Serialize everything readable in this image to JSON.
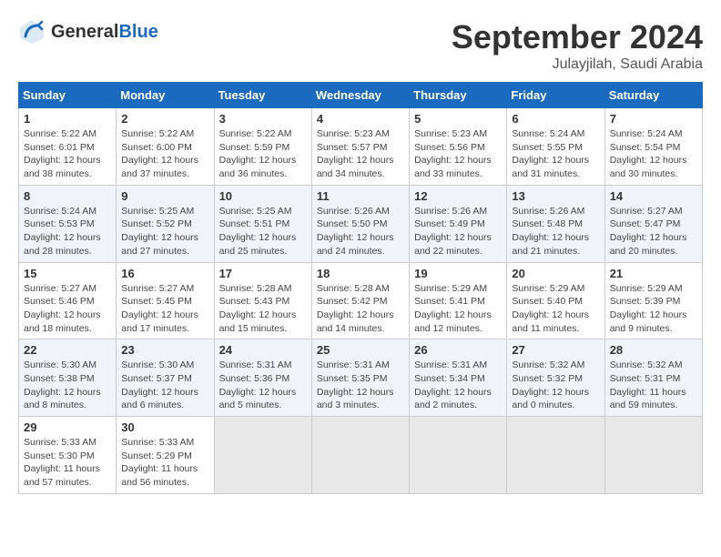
{
  "header": {
    "logo_general": "General",
    "logo_blue": "Blue",
    "month": "September 2024",
    "location": "Julayjilah, Saudi Arabia"
  },
  "weekdays": [
    "Sunday",
    "Monday",
    "Tuesday",
    "Wednesday",
    "Thursday",
    "Friday",
    "Saturday"
  ],
  "weeks": [
    [
      {
        "day": "1",
        "sunrise": "5:22 AM",
        "sunset": "6:01 PM",
        "daylight": "12 hours and 38 minutes."
      },
      {
        "day": "2",
        "sunrise": "5:22 AM",
        "sunset": "6:00 PM",
        "daylight": "12 hours and 37 minutes."
      },
      {
        "day": "3",
        "sunrise": "5:22 AM",
        "sunset": "5:59 PM",
        "daylight": "12 hours and 36 minutes."
      },
      {
        "day": "4",
        "sunrise": "5:23 AM",
        "sunset": "5:57 PM",
        "daylight": "12 hours and 34 minutes."
      },
      {
        "day": "5",
        "sunrise": "5:23 AM",
        "sunset": "5:56 PM",
        "daylight": "12 hours and 33 minutes."
      },
      {
        "day": "6",
        "sunrise": "5:24 AM",
        "sunset": "5:55 PM",
        "daylight": "12 hours and 31 minutes."
      },
      {
        "day": "7",
        "sunrise": "5:24 AM",
        "sunset": "5:54 PM",
        "daylight": "12 hours and 30 minutes."
      }
    ],
    [
      {
        "day": "8",
        "sunrise": "5:24 AM",
        "sunset": "5:53 PM",
        "daylight": "12 hours and 28 minutes."
      },
      {
        "day": "9",
        "sunrise": "5:25 AM",
        "sunset": "5:52 PM",
        "daylight": "12 hours and 27 minutes."
      },
      {
        "day": "10",
        "sunrise": "5:25 AM",
        "sunset": "5:51 PM",
        "daylight": "12 hours and 25 minutes."
      },
      {
        "day": "11",
        "sunrise": "5:26 AM",
        "sunset": "5:50 PM",
        "daylight": "12 hours and 24 minutes."
      },
      {
        "day": "12",
        "sunrise": "5:26 AM",
        "sunset": "5:49 PM",
        "daylight": "12 hours and 22 minutes."
      },
      {
        "day": "13",
        "sunrise": "5:26 AM",
        "sunset": "5:48 PM",
        "daylight": "12 hours and 21 minutes."
      },
      {
        "day": "14",
        "sunrise": "5:27 AM",
        "sunset": "5:47 PM",
        "daylight": "12 hours and 20 minutes."
      }
    ],
    [
      {
        "day": "15",
        "sunrise": "5:27 AM",
        "sunset": "5:46 PM",
        "daylight": "12 hours and 18 minutes."
      },
      {
        "day": "16",
        "sunrise": "5:27 AM",
        "sunset": "5:45 PM",
        "daylight": "12 hours and 17 minutes."
      },
      {
        "day": "17",
        "sunrise": "5:28 AM",
        "sunset": "5:43 PM",
        "daylight": "12 hours and 15 minutes."
      },
      {
        "day": "18",
        "sunrise": "5:28 AM",
        "sunset": "5:42 PM",
        "daylight": "12 hours and 14 minutes."
      },
      {
        "day": "19",
        "sunrise": "5:29 AM",
        "sunset": "5:41 PM",
        "daylight": "12 hours and 12 minutes."
      },
      {
        "day": "20",
        "sunrise": "5:29 AM",
        "sunset": "5:40 PM",
        "daylight": "12 hours and 11 minutes."
      },
      {
        "day": "21",
        "sunrise": "5:29 AM",
        "sunset": "5:39 PM",
        "daylight": "12 hours and 9 minutes."
      }
    ],
    [
      {
        "day": "22",
        "sunrise": "5:30 AM",
        "sunset": "5:38 PM",
        "daylight": "12 hours and 8 minutes."
      },
      {
        "day": "23",
        "sunrise": "5:30 AM",
        "sunset": "5:37 PM",
        "daylight": "12 hours and 6 minutes."
      },
      {
        "day": "24",
        "sunrise": "5:31 AM",
        "sunset": "5:36 PM",
        "daylight": "12 hours and 5 minutes."
      },
      {
        "day": "25",
        "sunrise": "5:31 AM",
        "sunset": "5:35 PM",
        "daylight": "12 hours and 3 minutes."
      },
      {
        "day": "26",
        "sunrise": "5:31 AM",
        "sunset": "5:34 PM",
        "daylight": "12 hours and 2 minutes."
      },
      {
        "day": "27",
        "sunrise": "5:32 AM",
        "sunset": "5:32 PM",
        "daylight": "12 hours and 0 minutes."
      },
      {
        "day": "28",
        "sunrise": "5:32 AM",
        "sunset": "5:31 PM",
        "daylight": "11 hours and 59 minutes."
      }
    ],
    [
      {
        "day": "29",
        "sunrise": "5:33 AM",
        "sunset": "5:30 PM",
        "daylight": "11 hours and 57 minutes."
      },
      {
        "day": "30",
        "sunrise": "5:33 AM",
        "sunset": "5:29 PM",
        "daylight": "11 hours and 56 minutes."
      },
      null,
      null,
      null,
      null,
      null
    ]
  ]
}
